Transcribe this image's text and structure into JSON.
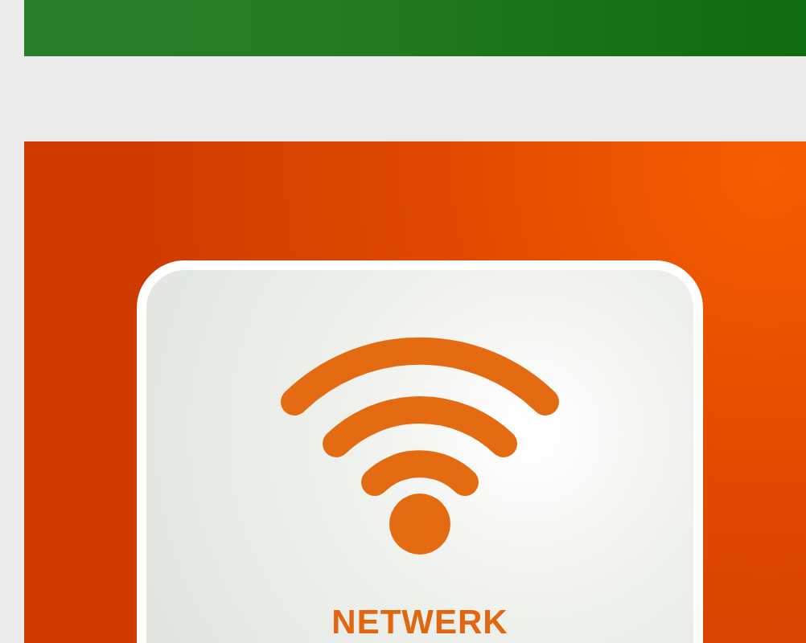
{
  "tile": {
    "label": "NETWERK"
  }
}
